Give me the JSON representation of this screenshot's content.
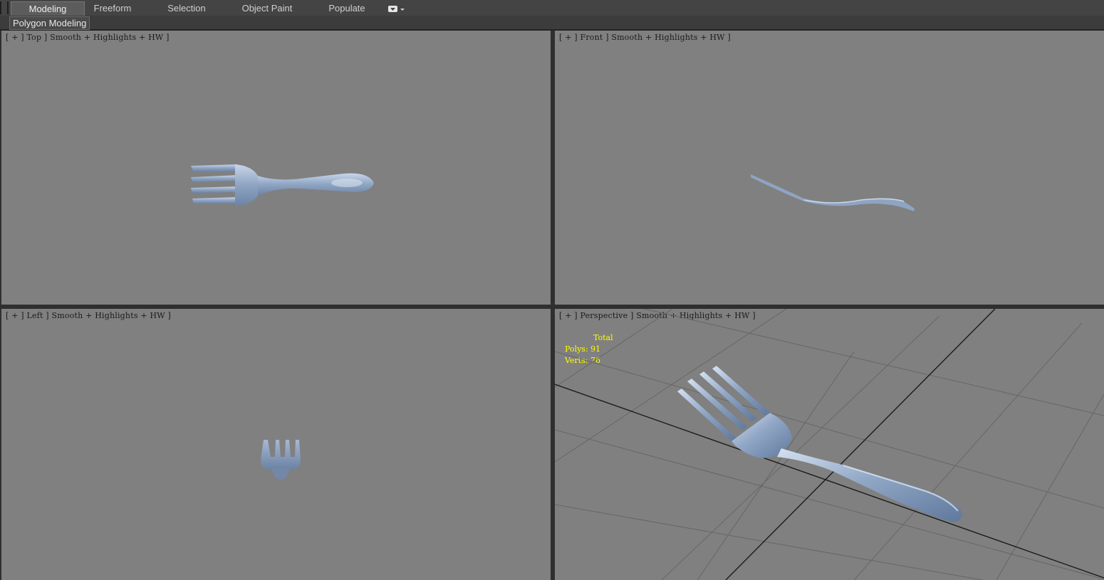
{
  "ribbon": {
    "tabs": [
      {
        "label": "Modeling",
        "active": true
      },
      {
        "label": "Freeform",
        "active": false
      },
      {
        "label": "Selection",
        "active": false
      },
      {
        "label": "Object Paint",
        "active": false
      },
      {
        "label": "Populate",
        "active": false
      }
    ]
  },
  "panel": {
    "label": "Polygon Modeling"
  },
  "viewports": {
    "top": {
      "label": "[ + ] Top ] Smooth + Highlights + HW ]"
    },
    "front": {
      "label": "[ + ] Front ] Smooth + Highlights + HW ]"
    },
    "left": {
      "label": "[ + ] Left ] Smooth + Highlights + HW ]"
    },
    "perspective": {
      "label": "[ + ] Perspective ] Smooth + Highlights + HW ]"
    }
  },
  "stats": {
    "header": "Total",
    "polys_label": "Polys:",
    "polys_value": "91",
    "verts_label": "Verts:",
    "verts_value": "76"
  },
  "colors": {
    "viewport_bg": "#808080",
    "object": "#8ea4c2",
    "stats_text": "#ffff00",
    "grid": "#1a1a1a"
  }
}
